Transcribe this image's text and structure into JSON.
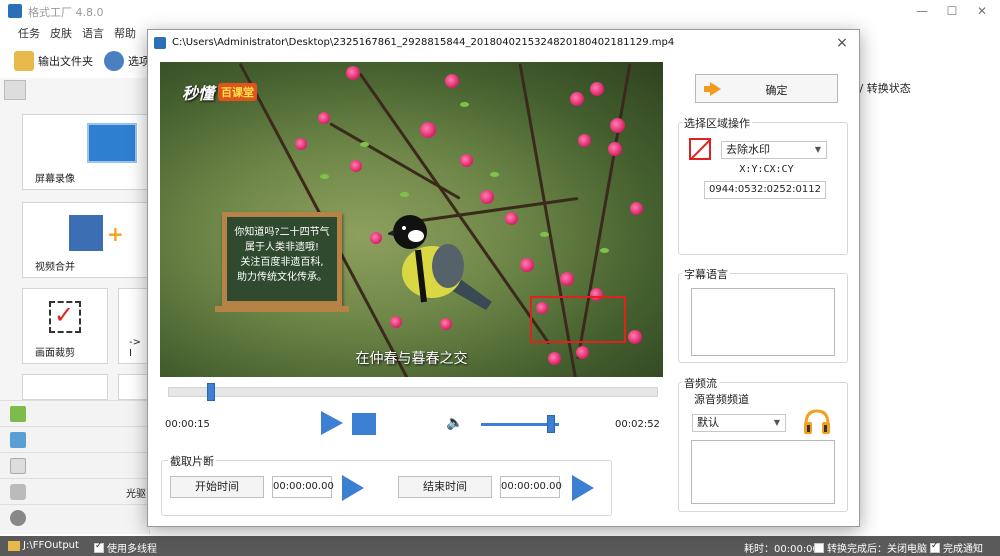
{
  "app": {
    "title": "格式工厂 4.8.0",
    "menu": [
      "任务",
      "皮肤",
      "语言",
      "帮助"
    ],
    "toolbar": {
      "output_folder": "输出文件夹",
      "options": "选项"
    },
    "right_header": "出 / 转换状态",
    "tiles": [
      "屏幕录像",
      "视频合并",
      "画面裁剪",
      "-> I",
      "光驱"
    ]
  },
  "status_bar": {
    "output_path": "J:\\FFOutput",
    "multithread": "使用多线程",
    "elapsed": "耗时：00:00:00",
    "after_done": "转换完成后：关闭电脑",
    "notify": "完成通知"
  },
  "dialog": {
    "title": "C:\\Users\\Administrator\\Desktop\\2325167861_2928815844_20180402153248201804021811​29.mp4",
    "close_label": "×",
    "video": {
      "logo_main": "秒懂",
      "logo_sub": "百课堂",
      "chalkboard_lines": [
        "你知道吗?二十四节气",
        "属于人类非遗哦!",
        "关注百度非遗百科,",
        "助力传统文化传承。"
      ],
      "subtitle": "在仲春与暮春之交"
    },
    "player": {
      "current_time": "00:00:15",
      "total_time": "00:02:52",
      "progress": 0.087,
      "volume": 0.9
    },
    "clip": {
      "legend": "截取片断",
      "start_button": "开始时间",
      "start_value": "00:00:00.00",
      "end_button": "结束时间",
      "end_value": "00:00:00.00"
    },
    "ok_button": "确定",
    "region": {
      "legend": "选择区域操作",
      "mode": "去除水印",
      "coord_format": "X:Y:CX:CY",
      "coord_value": "0944:0532:0252:0112"
    },
    "subtitle_lang": {
      "legend": "字幕语言"
    },
    "audio": {
      "legend": "音频流",
      "source_label": "源音频频道",
      "channel": "默认"
    }
  },
  "colors": {
    "accent": "#3d7fd3",
    "selection": "#e0221e",
    "ok_arrow": "#f29a1e"
  }
}
